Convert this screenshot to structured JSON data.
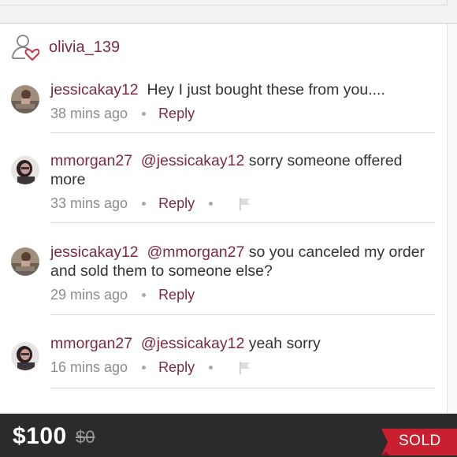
{
  "owner": {
    "username": "olivia_139",
    "icon": "user-heart-icon"
  },
  "comments": [
    {
      "username": "jessicakay12",
      "mention": "",
      "text": "Hey I just bought these from you....",
      "time": "38 mins ago",
      "reply_label": "Reply",
      "flag": false
    },
    {
      "username": "mmorgan27",
      "mention": "@jessicakay12",
      "text": "sorry someone offered more",
      "time": "33 mins ago",
      "reply_label": "Reply",
      "flag": true
    },
    {
      "username": "jessicakay12",
      "mention": "@mmorgan27",
      "text": "so you canceled my order and sold them to someone else?",
      "time": "29 mins ago",
      "reply_label": "Reply",
      "flag": false
    },
    {
      "username": "mmorgan27",
      "mention": "@jessicakay12",
      "text": "yeah sorry",
      "time": "16 mins ago",
      "reply_label": "Reply",
      "flag": true
    }
  ],
  "listing": {
    "price": "$100",
    "original_price": "$0",
    "status": "SOLD",
    "status_color": "#c8202f"
  },
  "colors": {
    "accent": "#7b2b3d",
    "meta": "#8c8c8c",
    "footer_bg": "#2b2b2b"
  }
}
